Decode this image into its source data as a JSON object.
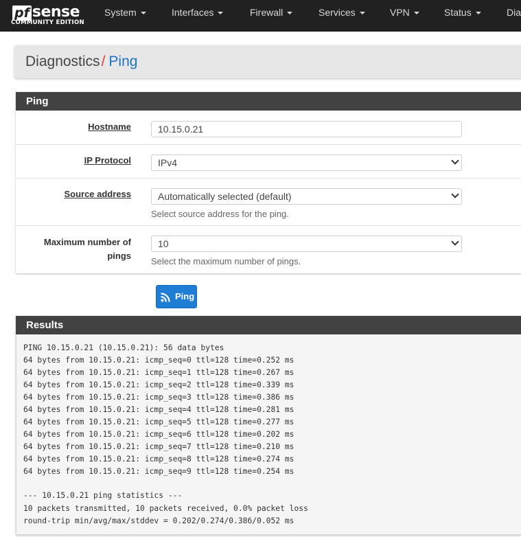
{
  "brand": {
    "logo_pf": "pf",
    "logo_sense": "sense",
    "logo_sub": "COMMUNITY EDITION"
  },
  "nav": [
    {
      "label": "System",
      "caret": true
    },
    {
      "label": "Interfaces",
      "caret": true
    },
    {
      "label": "Firewall",
      "caret": true
    },
    {
      "label": "Services",
      "caret": true
    },
    {
      "label": "VPN",
      "caret": true
    },
    {
      "label": "Status",
      "caret": true
    },
    {
      "label": "Dia",
      "caret": false
    }
  ],
  "breadcrumb": {
    "parent": "Diagnostics",
    "separator": "/",
    "current": "Ping"
  },
  "ping_panel": {
    "title": "Ping",
    "hostname": {
      "label": "Hostname",
      "value": "10.15.0.21"
    },
    "ip_protocol": {
      "label": "IP Protocol",
      "selected": "IPv4"
    },
    "source_address": {
      "label": "Source address",
      "selected": "Automatically selected (default)",
      "help": "Select source address for the ping."
    },
    "max_pings": {
      "label_line1": "Maximum number of",
      "label_line2": "pings",
      "selected": "10",
      "help": "Select the maximum number of pings."
    }
  },
  "ping_button": {
    "label": "Ping",
    "icon": "rss-icon"
  },
  "results": {
    "title": "Results",
    "lines": [
      "PING 10.15.0.21 (10.15.0.21): 56 data bytes",
      "64 bytes from 10.15.0.21: icmp_seq=0 ttl=128 time=0.252 ms",
      "64 bytes from 10.15.0.21: icmp_seq=1 ttl=128 time=0.267 ms",
      "64 bytes from 10.15.0.21: icmp_seq=2 ttl=128 time=0.339 ms",
      "64 bytes from 10.15.0.21: icmp_seq=3 ttl=128 time=0.386 ms",
      "64 bytes from 10.15.0.21: icmp_seq=4 ttl=128 time=0.281 ms",
      "64 bytes from 10.15.0.21: icmp_seq=5 ttl=128 time=0.277 ms",
      "64 bytes from 10.15.0.21: icmp_seq=6 ttl=128 time=0.202 ms",
      "64 bytes from 10.15.0.21: icmp_seq=7 ttl=128 time=0.210 ms",
      "64 bytes from 10.15.0.21: icmp_seq=8 ttl=128 time=0.274 ms",
      "64 bytes from 10.15.0.21: icmp_seq=9 ttl=128 time=0.254 ms",
      "",
      "--- 10.15.0.21 ping statistics ---",
      "10 packets transmitted, 10 packets received, 0.0% packet loss",
      "round-trip min/avg/max/stddev = 0.202/0.274/0.386/0.052 ms"
    ]
  },
  "colors": {
    "navbar": "#212121",
    "panel_heading": "#424242",
    "accent": "#1e7ed6",
    "breadcrumb_sep": "#e53935",
    "link": "#1e73c4"
  }
}
